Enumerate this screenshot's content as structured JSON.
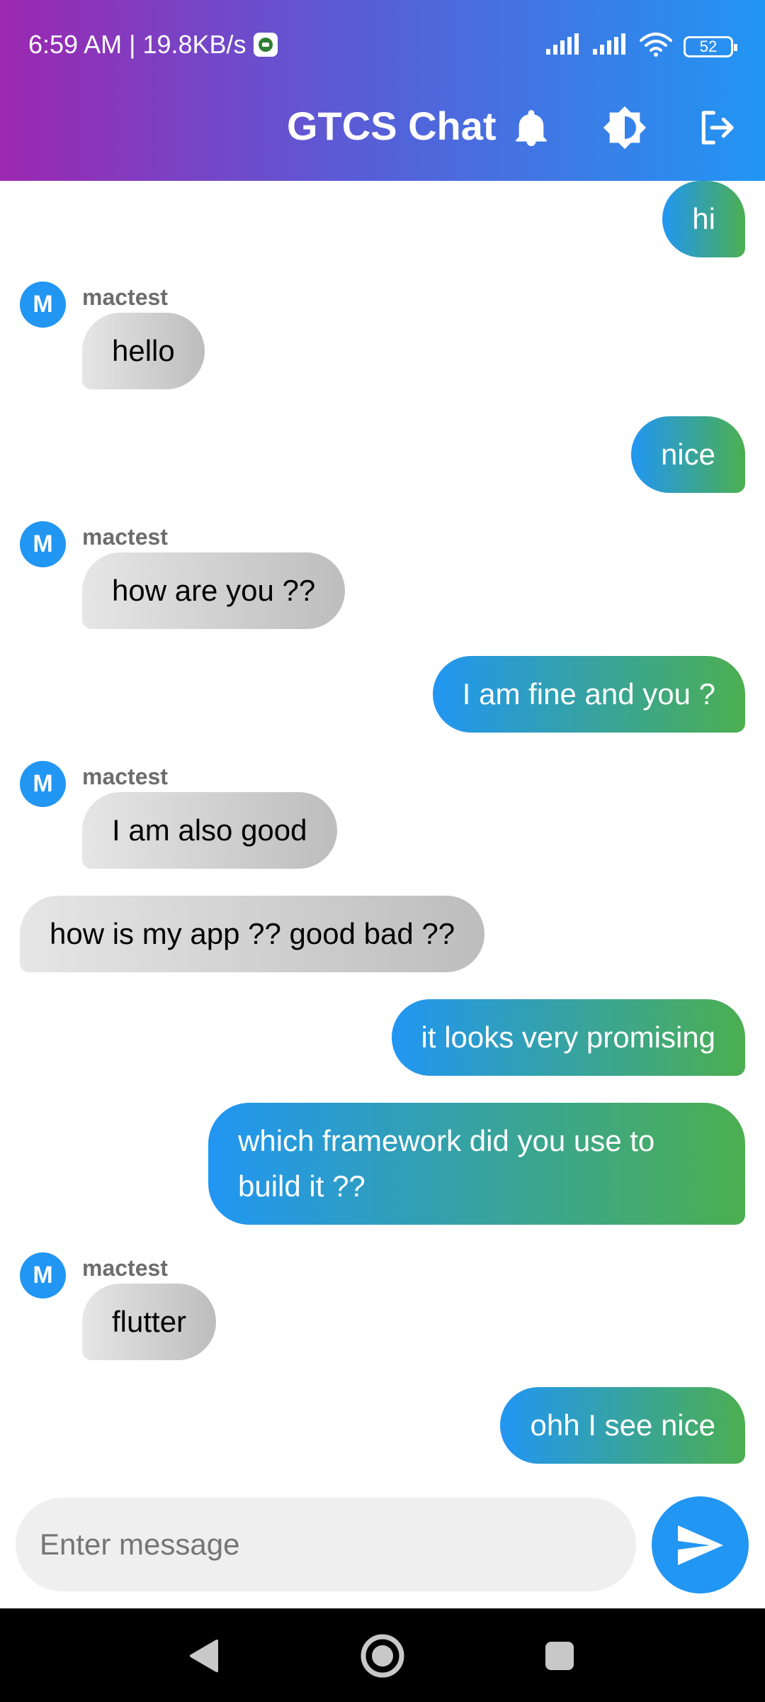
{
  "status_bar": {
    "time_speed": "6:59 AM | 19.8KB/s",
    "battery": "52"
  },
  "app_bar": {
    "title": "GTCS Chat",
    "actions": [
      "bell-icon",
      "brightness-icon",
      "logout-icon"
    ]
  },
  "messages": [
    {
      "type": "sent",
      "text": "hi"
    },
    {
      "type": "received",
      "sender": "mactest",
      "avatar": "M",
      "text": "hello"
    },
    {
      "type": "sent",
      "text": "nice"
    },
    {
      "type": "received",
      "sender": "mactest",
      "avatar": "M",
      "text": "how are you ??"
    },
    {
      "type": "sent",
      "text": "I am fine and you ?"
    },
    {
      "type": "received",
      "sender": "mactest",
      "avatar": "M",
      "text": "I am also good"
    },
    {
      "type": "received",
      "text": "how is my app ?? good bad ??"
    },
    {
      "type": "sent",
      "text": "it looks very promising"
    },
    {
      "type": "sent",
      "text": "which framework did you use to build it ??"
    },
    {
      "type": "received",
      "sender": "mactest",
      "avatar": "M",
      "text": "flutter"
    },
    {
      "type": "sent",
      "text": "ohh I see nice"
    }
  ],
  "composer": {
    "placeholder": "Enter message",
    "value": ""
  },
  "colors": {
    "header_start": "#9c27b0",
    "header_end": "#2196f3",
    "sent_start": "#2196f3",
    "sent_end": "#4caf50",
    "avatar": "#2196f3"
  }
}
